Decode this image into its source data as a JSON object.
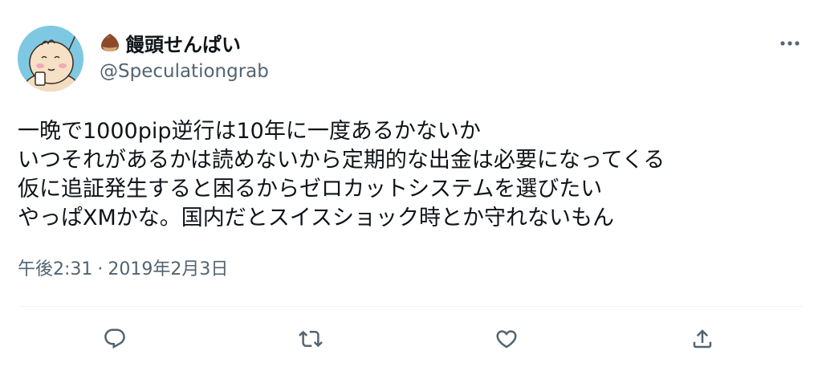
{
  "tweet": {
    "author": {
      "display_name": "饅頭せんぱい",
      "name_emoji": "chestnut-icon",
      "handle": "@Speculationgrab",
      "avatar": "cartoon-avatar"
    },
    "body_lines": [
      "一晩で1000pip逆行は10年に一度あるかないか",
      "いつそれがあるかは読めないから定期的な出金は必要になってくる",
      "仮に追証発生すると困るからゼロカットシステムを選びたい",
      "やっぱXMかな。国内だとスイスショック時とか守れないもん"
    ],
    "time": "午後2:31",
    "separator": "·",
    "date": "2019年2月3日"
  },
  "actions": {
    "icons": [
      "reply-icon",
      "retweet-icon",
      "like-icon",
      "share-icon"
    ]
  },
  "colors": {
    "text": "#0f1419",
    "secondary": "#536471",
    "divider": "#eff3f4",
    "avatar_bg": "#7fc8e2"
  }
}
